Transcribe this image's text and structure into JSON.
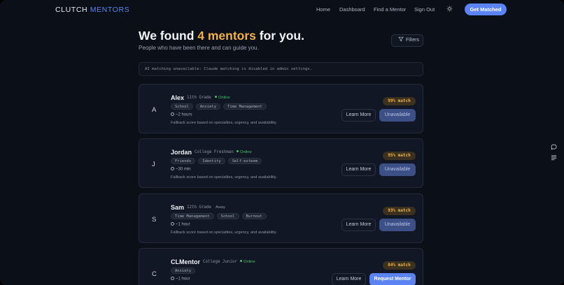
{
  "nav": {
    "brand_left": "CLUTCH",
    "brand_right": "MENTORS",
    "links": [
      "Home",
      "Dashboard",
      "Find a Mentor",
      "Sign Out"
    ],
    "cta": "Get Matched",
    "theme_icon": "sun-icon"
  },
  "header": {
    "title_pre": "We found",
    "title_highlight": "4 mentors",
    "title_post": "for you.",
    "subtitle": "People who have been there and can guide you.",
    "filters_label": "Filters"
  },
  "notice": "AI matching unavailable: Claude matching is disabled in admin settings.",
  "mentors": [
    {
      "initial": "A",
      "name": "Alex",
      "grade": "11th Grade",
      "status": "Online",
      "tags": [
        "School",
        "Anxiety",
        "Time Management"
      ],
      "response_time": "~2 hours",
      "note": "Fallback score based on specialties, urgency, and availability.",
      "match": "99% match",
      "learn_label": "Learn More",
      "action_label": "Unavailable"
    },
    {
      "initial": "J",
      "name": "Jordan",
      "grade": "College Freshman",
      "status": "Online",
      "tags": [
        "Friends",
        "Identity",
        "Self-esteem"
      ],
      "response_time": "~30 min",
      "note": "Fallback score based on specialties, urgency, and availability.",
      "match": "95% match",
      "learn_label": "Learn More",
      "action_label": "Unavailable"
    },
    {
      "initial": "S",
      "name": "Sam",
      "grade": "12th Grade",
      "status": "Away",
      "tags": [
        "Time Management",
        "School",
        "Burnout"
      ],
      "response_time": "~1 hour",
      "note": "Fallback score based on specialties, urgency, and availability.",
      "match": "93% match",
      "learn_label": "Learn More",
      "action_label": "Unavailable"
    },
    {
      "initial": "C",
      "name": "CLMentor",
      "grade": "College Junior",
      "status": "Online",
      "tags": [
        "Anxiety"
      ],
      "response_time": "~1 hour",
      "match": "84% match",
      "learn_label": "Learn More",
      "action_label": "Request Mentor"
    }
  ],
  "side_icons": [
    "chat-icon",
    "list-icon"
  ]
}
